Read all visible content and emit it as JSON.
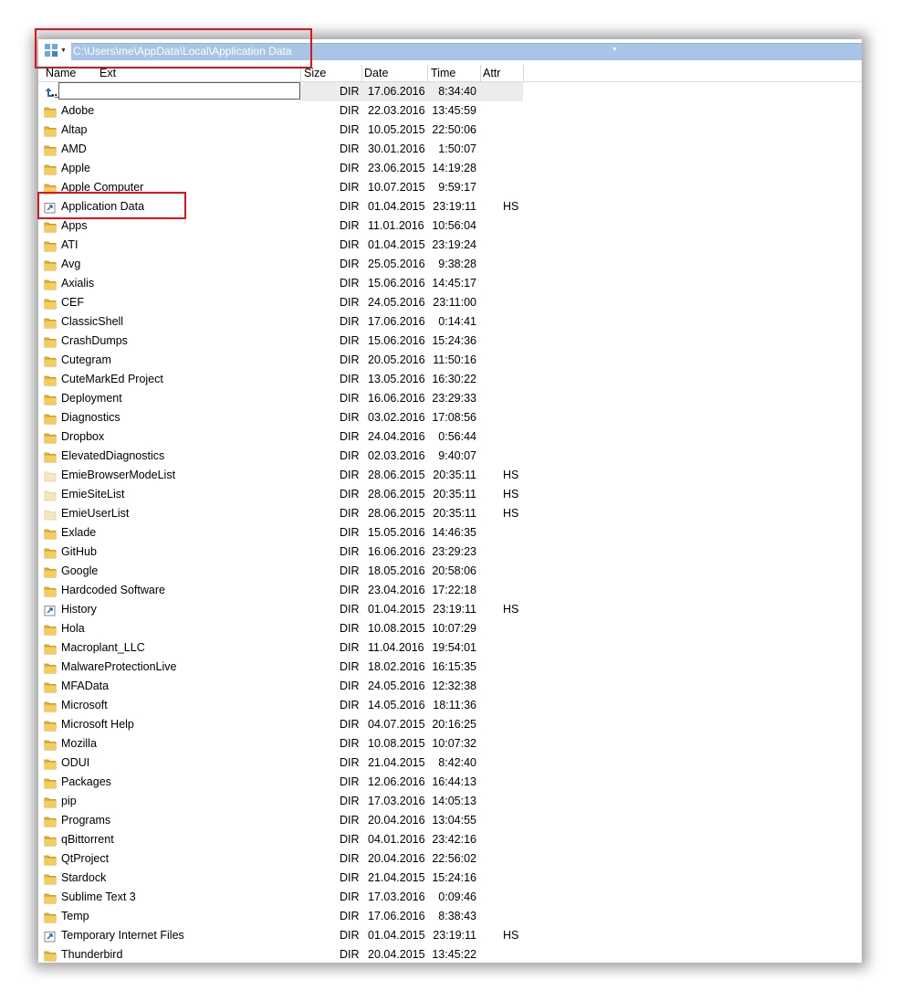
{
  "path_bar": {
    "path": "C:\\Users\\me\\AppData\\Local\\Application Data",
    "drive_icon": "drive-icon",
    "drive_menu_icon": "chevron-down-icon",
    "dropdown_icon": "chevron-down-icon"
  },
  "columns": {
    "name": "Name",
    "ext": "Ext",
    "size": "Size",
    "date": "Date",
    "time": "Time",
    "attr": "Attr"
  },
  "colors": {
    "path_field_bg": "#a7c6e7",
    "folder": "#e8b32f",
    "highlight": "#e0121b"
  },
  "rows": [
    {
      "name": "..",
      "icon": "up-folder-icon",
      "size": "DIR",
      "date": "17.06.2016",
      "time": "8:34:40",
      "attr": ""
    },
    {
      "name": "Adobe",
      "icon": "folder-icon",
      "size": "DIR",
      "date": "22.03.2016",
      "time": "13:45:59",
      "attr": ""
    },
    {
      "name": "Altap",
      "icon": "folder-icon",
      "size": "DIR",
      "date": "10.05.2015",
      "time": "22:50:06",
      "attr": ""
    },
    {
      "name": "AMD",
      "icon": "folder-icon",
      "size": "DIR",
      "date": "30.01.2016",
      "time": "1:50:07",
      "attr": ""
    },
    {
      "name": "Apple",
      "icon": "folder-icon",
      "size": "DIR",
      "date": "23.06.2015",
      "time": "14:19:28",
      "attr": ""
    },
    {
      "name": "Apple Computer",
      "icon": "folder-icon",
      "size": "DIR",
      "date": "10.07.2015",
      "time": "9:59:17",
      "attr": ""
    },
    {
      "name": "Application Data",
      "icon": "shortcut-folder-icon",
      "size": "DIR",
      "date": "01.04.2015",
      "time": "23:19:11",
      "attr": "HS"
    },
    {
      "name": "Apps",
      "icon": "folder-icon",
      "size": "DIR",
      "date": "11.01.2016",
      "time": "10:56:04",
      "attr": ""
    },
    {
      "name": "ATI",
      "icon": "folder-icon",
      "size": "DIR",
      "date": "01.04.2015",
      "time": "23:19:24",
      "attr": ""
    },
    {
      "name": "Avg",
      "icon": "folder-icon",
      "size": "DIR",
      "date": "25.05.2016",
      "time": "9:38:28",
      "attr": ""
    },
    {
      "name": "Axialis",
      "icon": "folder-icon",
      "size": "DIR",
      "date": "15.06.2016",
      "time": "14:45:17",
      "attr": ""
    },
    {
      "name": "CEF",
      "icon": "folder-icon",
      "size": "DIR",
      "date": "24.05.2016",
      "time": "23:11:00",
      "attr": ""
    },
    {
      "name": "ClassicShell",
      "icon": "folder-icon",
      "size": "DIR",
      "date": "17.06.2016",
      "time": "0:14:41",
      "attr": ""
    },
    {
      "name": "CrashDumps",
      "icon": "folder-icon",
      "size": "DIR",
      "date": "15.06.2016",
      "time": "15:24:36",
      "attr": ""
    },
    {
      "name": "Cutegram",
      "icon": "folder-icon",
      "size": "DIR",
      "date": "20.05.2016",
      "time": "11:50:16",
      "attr": ""
    },
    {
      "name": "CuteMarkEd Project",
      "icon": "folder-icon",
      "size": "DIR",
      "date": "13.05.2016",
      "time": "16:30:22",
      "attr": ""
    },
    {
      "name": "Deployment",
      "icon": "folder-icon",
      "size": "DIR",
      "date": "16.06.2016",
      "time": "23:29:33",
      "attr": ""
    },
    {
      "name": "Diagnostics",
      "icon": "folder-icon",
      "size": "DIR",
      "date": "03.02.2016",
      "time": "17:08:56",
      "attr": ""
    },
    {
      "name": "Dropbox",
      "icon": "folder-icon",
      "size": "DIR",
      "date": "24.04.2016",
      "time": "0:56:44",
      "attr": ""
    },
    {
      "name": "ElevatedDiagnostics",
      "icon": "folder-icon",
      "size": "DIR",
      "date": "02.03.2016",
      "time": "9:40:07",
      "attr": ""
    },
    {
      "name": "EmieBrowserModeList",
      "icon": "hidden-folder-icon",
      "size": "DIR",
      "date": "28.06.2015",
      "time": "20:35:11",
      "attr": "HS"
    },
    {
      "name": "EmieSiteList",
      "icon": "hidden-folder-icon",
      "size": "DIR",
      "date": "28.06.2015",
      "time": "20:35:11",
      "attr": "HS"
    },
    {
      "name": "EmieUserList",
      "icon": "hidden-folder-icon",
      "size": "DIR",
      "date": "28.06.2015",
      "time": "20:35:11",
      "attr": "HS"
    },
    {
      "name": "Exlade",
      "icon": "folder-icon",
      "size": "DIR",
      "date": "15.05.2016",
      "time": "14:46:35",
      "attr": ""
    },
    {
      "name": "GitHub",
      "icon": "folder-icon",
      "size": "DIR",
      "date": "16.06.2016",
      "time": "23:29:23",
      "attr": ""
    },
    {
      "name": "Google",
      "icon": "folder-icon",
      "size": "DIR",
      "date": "18.05.2016",
      "time": "20:58:06",
      "attr": ""
    },
    {
      "name": "Hardcoded Software",
      "icon": "folder-icon",
      "size": "DIR",
      "date": "23.04.2016",
      "time": "17:22:18",
      "attr": ""
    },
    {
      "name": "History",
      "icon": "shortcut-folder-icon",
      "size": "DIR",
      "date": "01.04.2015",
      "time": "23:19:11",
      "attr": "HS"
    },
    {
      "name": "Hola",
      "icon": "folder-icon",
      "size": "DIR",
      "date": "10.08.2015",
      "time": "10:07:29",
      "attr": ""
    },
    {
      "name": "Macroplant_LLC",
      "icon": "folder-icon",
      "size": "DIR",
      "date": "11.04.2016",
      "time": "19:54:01",
      "attr": ""
    },
    {
      "name": "MalwareProtectionLive",
      "icon": "folder-icon",
      "size": "DIR",
      "date": "18.02.2016",
      "time": "16:15:35",
      "attr": ""
    },
    {
      "name": "MFAData",
      "icon": "folder-icon",
      "size": "DIR",
      "date": "24.05.2016",
      "time": "12:32:38",
      "attr": ""
    },
    {
      "name": "Microsoft",
      "icon": "folder-icon",
      "size": "DIR",
      "date": "14.05.2016",
      "time": "18:11:36",
      "attr": ""
    },
    {
      "name": "Microsoft Help",
      "icon": "folder-icon",
      "size": "DIR",
      "date": "04.07.2015",
      "time": "20:16:25",
      "attr": ""
    },
    {
      "name": "Mozilla",
      "icon": "folder-icon",
      "size": "DIR",
      "date": "10.08.2015",
      "time": "10:07:32",
      "attr": ""
    },
    {
      "name": "ODUI",
      "icon": "folder-icon",
      "size": "DIR",
      "date": "21.04.2015",
      "time": "8:42:40",
      "attr": ""
    },
    {
      "name": "Packages",
      "icon": "folder-icon",
      "size": "DIR",
      "date": "12.06.2016",
      "time": "16:44:13",
      "attr": ""
    },
    {
      "name": "pip",
      "icon": "folder-icon",
      "size": "DIR",
      "date": "17.03.2016",
      "time": "14:05:13",
      "attr": ""
    },
    {
      "name": "Programs",
      "icon": "folder-icon",
      "size": "DIR",
      "date": "20.04.2016",
      "time": "13:04:55",
      "attr": ""
    },
    {
      "name": "qBittorrent",
      "icon": "folder-icon",
      "size": "DIR",
      "date": "04.01.2016",
      "time": "23:42:16",
      "attr": ""
    },
    {
      "name": "QtProject",
      "icon": "folder-icon",
      "size": "DIR",
      "date": "20.04.2016",
      "time": "22:56:02",
      "attr": ""
    },
    {
      "name": "Stardock",
      "icon": "folder-icon",
      "size": "DIR",
      "date": "21.04.2015",
      "time": "15:24:16",
      "attr": ""
    },
    {
      "name": "Sublime Text 3",
      "icon": "folder-icon",
      "size": "DIR",
      "date": "17.03.2016",
      "time": "0:09:46",
      "attr": ""
    },
    {
      "name": "Temp",
      "icon": "folder-icon",
      "size": "DIR",
      "date": "17.06.2016",
      "time": "8:38:43",
      "attr": ""
    },
    {
      "name": "Temporary Internet Files",
      "icon": "shortcut-folder-icon",
      "size": "DIR",
      "date": "01.04.2015",
      "time": "23:19:11",
      "attr": "HS"
    },
    {
      "name": "Thunderbird",
      "icon": "folder-icon",
      "size": "DIR",
      "date": "20.04.2015",
      "time": "13:45:22",
      "attr": ""
    }
  ]
}
